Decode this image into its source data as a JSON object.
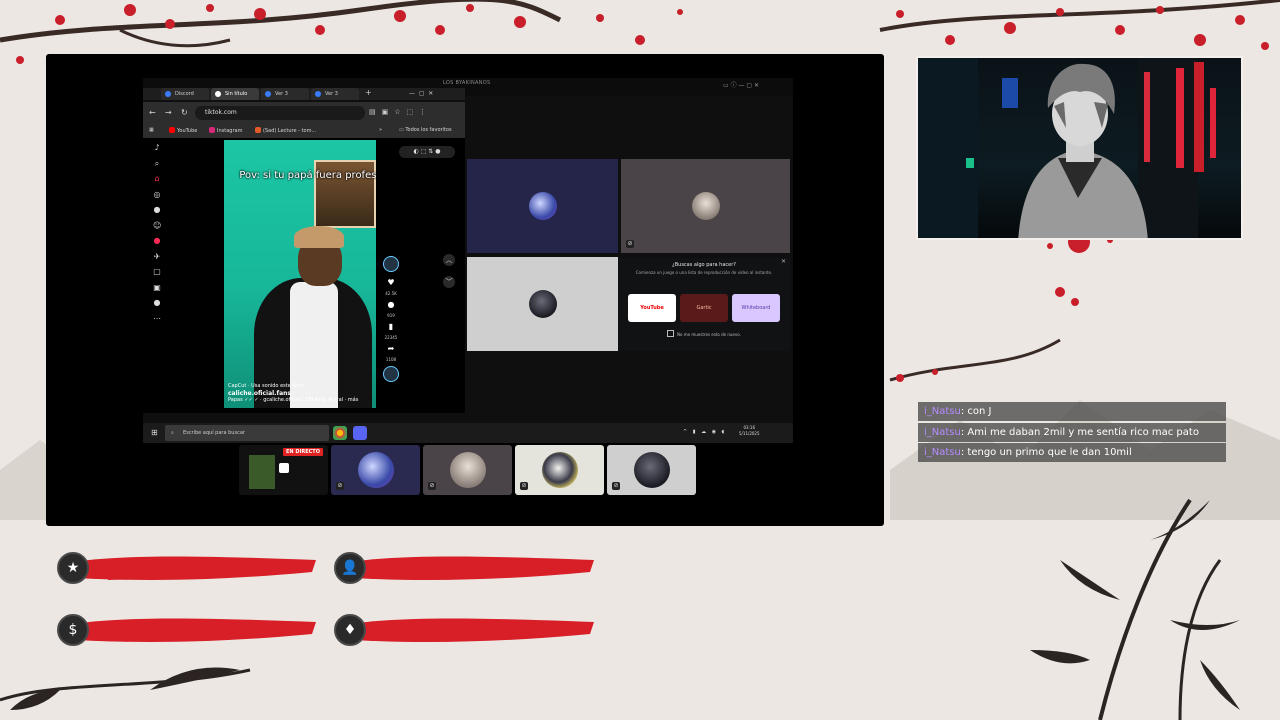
{
  "browser": {
    "window_title": "LOS BYAKINANOS",
    "tabs": [
      {
        "label": "Discord"
      },
      {
        "label": "Sin título"
      },
      {
        "label": "Ver 3"
      },
      {
        "label": "Ver 3"
      }
    ],
    "new_tab": "+",
    "url": "tiktok.com",
    "bookmarks": [
      {
        "label": "YouTube",
        "color": "#ff0000"
      },
      {
        "label": "Instagram",
        "color": "#d62976"
      },
      {
        "label": "(Sad) Lecture - tom...",
        "color": "#e05a2a"
      }
    ],
    "all_bookmarks": "Todos los favoritos"
  },
  "tiktok": {
    "caption": "Pov: si tu papá fuera profesor",
    "capcut": "CapCut · Usa sonido este libro",
    "account": "caliche.oficial.fans",
    "sound": "Papas ✓✓ ✓ · gcaliche.oficial1 58k#fyp #viral ·",
    "more": "más",
    "counts": [
      "42.5K",
      "919",
      "22345",
      "1108"
    ]
  },
  "discord": {
    "activity_title": "¿Buscas algo para hacer?",
    "activity_sub": "Comienza un juego o una lista de reproducción de vídeo al instante.",
    "cards": [
      {
        "label": "YouTube"
      },
      {
        "label": "Gartic"
      },
      {
        "label": "Whiteboard"
      }
    ],
    "dont_show": "No me muestres esto de nuevo.",
    "live_badge": "EN DIRECTO"
  },
  "taskbar": {
    "search_placeholder": "Escribe aquí para buscar",
    "time": "03:16",
    "date": "5/11/2025"
  },
  "chat": {
    "messages": [
      {
        "user": "i_Natsu",
        "text": ": con J"
      },
      {
        "user": "i_Natsu",
        "text": ": Ami me daban 2mil y me sentía rico mac pato"
      },
      {
        "user": "i_Natsu",
        "text": ": tengo un primo que le dan 10mil"
      }
    ]
  },
  "panels": [
    {
      "icon": "star-icon",
      "glyph": "★"
    },
    {
      "icon": "user-icon",
      "glyph": "👤"
    },
    {
      "icon": "dollar-icon",
      "glyph": "$"
    },
    {
      "icon": "diamond-icon",
      "glyph": "♦"
    }
  ],
  "colors": {
    "accent_red": "#d81e26",
    "chat_user": "#b58cff",
    "background": "#ece7e2"
  }
}
